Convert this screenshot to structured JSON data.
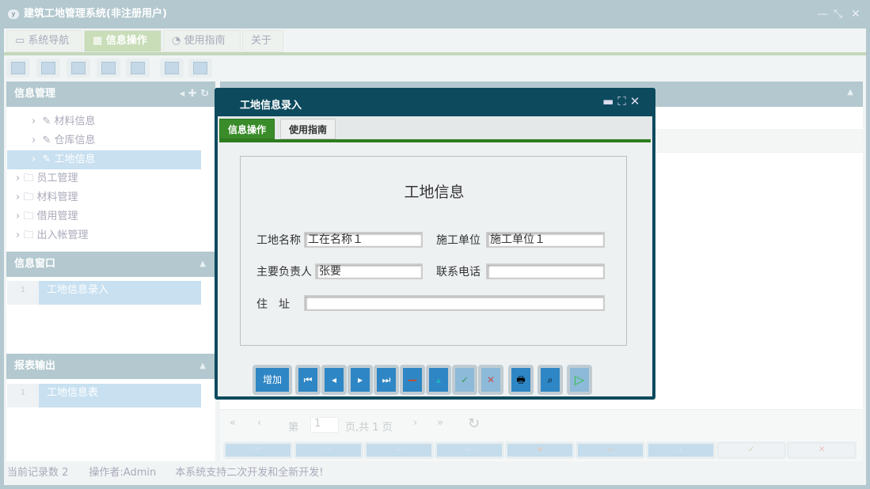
{
  "window": {
    "title": "建筑工地管理系统(非注册用户)",
    "controls": [
      "—",
      "⤡",
      "✕"
    ]
  },
  "menu_tabs": [
    {
      "label": "系统导航"
    },
    {
      "label": "信息操作"
    },
    {
      "label": "使用指南"
    },
    {
      "label": "关于"
    }
  ],
  "left": {
    "info_mgmt": {
      "title": "信息管理",
      "tree": [
        {
          "label": "材料信息"
        },
        {
          "label": "仓库信息"
        },
        {
          "label": "工地信息"
        },
        {
          "label": "员工管理"
        },
        {
          "label": "材料管理"
        },
        {
          "label": "借用管理"
        },
        {
          "label": "出入帐管理"
        }
      ]
    },
    "info_window": {
      "title": "信息窗口",
      "items": [
        {
          "num": "1",
          "label": "工地信息录入"
        }
      ]
    },
    "report": {
      "title": "报表输出",
      "items": [
        {
          "num": "1",
          "label": "工地信息表"
        }
      ]
    }
  },
  "dialog": {
    "title": "工地信息录入",
    "tabs": [
      {
        "label": "信息操作"
      },
      {
        "label": "使用指南"
      }
    ],
    "form_title": "工地信息",
    "fields": {
      "site_name": {
        "label": "工地名称",
        "value": "工在名称１"
      },
      "builder": {
        "label": "施工单位",
        "value": "施工单位１"
      },
      "manager": {
        "label": "主要负责人",
        "value": "张要"
      },
      "phone": {
        "label": "联系电话",
        "value": ""
      },
      "address": {
        "label": "住　址",
        "value": ""
      }
    },
    "buttons": {
      "add": "增加"
    }
  },
  "pager": {
    "page_label": "第",
    "page": "1",
    "total_label": "页,共 1 页"
  },
  "status": {
    "records": "当前记录数 2",
    "operator": "操作者:Admin",
    "note": "本系统支持二次开发和全新开发!"
  }
}
